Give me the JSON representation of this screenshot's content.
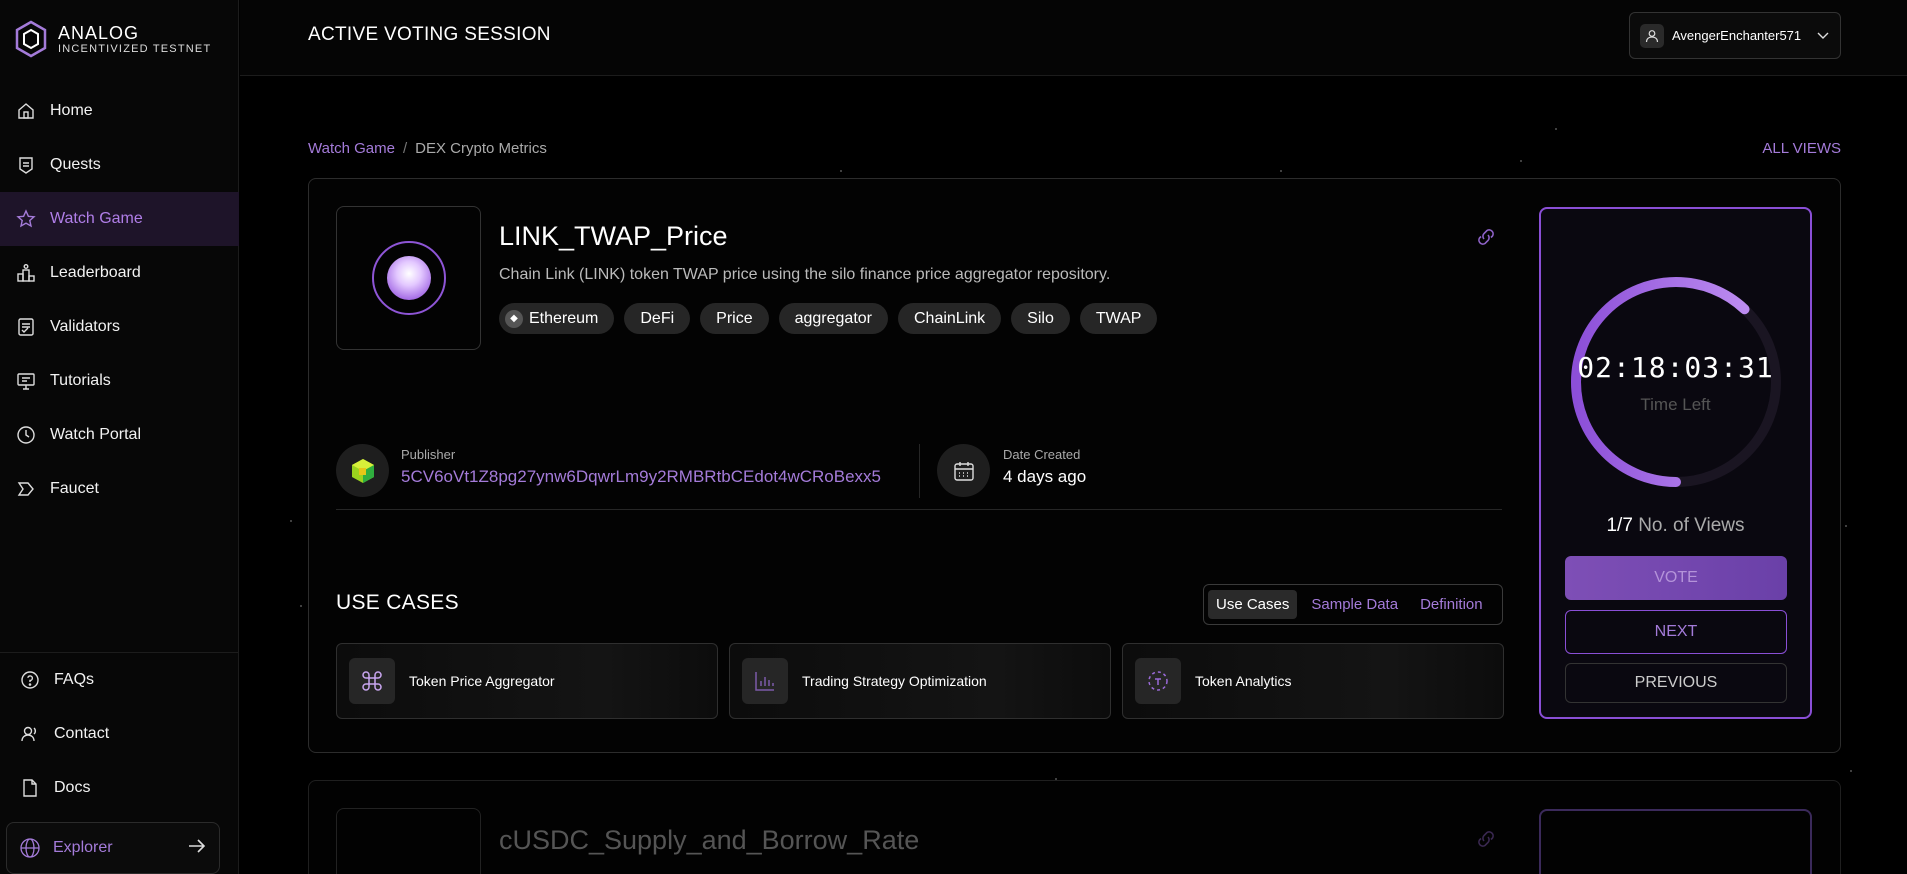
{
  "app": {
    "logo_title": "ANALOG",
    "logo_subtitle": "INCENTIVIZED TESTNET"
  },
  "sidebar": {
    "items": [
      {
        "label": "Home",
        "icon": "home-icon"
      },
      {
        "label": "Quests",
        "icon": "quests-icon"
      },
      {
        "label": "Watch Game",
        "icon": "star-icon",
        "active": true
      },
      {
        "label": "Leaderboard",
        "icon": "leaderboard-icon"
      },
      {
        "label": "Validators",
        "icon": "validators-icon"
      },
      {
        "label": "Tutorials",
        "icon": "tutorials-icon"
      },
      {
        "label": "Watch Portal",
        "icon": "clock-icon"
      },
      {
        "label": "Faucet",
        "icon": "faucet-icon"
      }
    ],
    "bottom_items": [
      {
        "label": "FAQs",
        "icon": "question-icon"
      },
      {
        "label": "Contact",
        "icon": "contact-icon"
      },
      {
        "label": "Docs",
        "icon": "docs-icon"
      }
    ],
    "explorer_label": "Explorer"
  },
  "header": {
    "title": "ACTIVE VOTING SESSION",
    "username": "AvengerEnchanter571"
  },
  "breadcrumb": {
    "root": "Watch Game",
    "separator": "/",
    "current": "DEX Crypto Metrics",
    "all_views": "ALL VIEWS"
  },
  "view": {
    "title": "LINK_TWAP_Price",
    "description": "Chain Link (LINK) token TWAP price using the silo finance price aggregator repository.",
    "tags": [
      "Ethereum",
      "DeFi",
      "Price",
      "aggregator",
      "ChainLink",
      "Silo",
      "TWAP"
    ],
    "publisher_label": "Publisher",
    "publisher": "5CV6oVt1Z8pg27ynw6DqwrLm9y2RMBRtbCEdot4wCRoBexx5",
    "date_label": "Date Created",
    "date": "4 days ago"
  },
  "use_cases": {
    "heading": "USE CASES",
    "tabs": [
      "Use Cases",
      "Sample Data",
      "Definition"
    ],
    "active_tab": "Use Cases",
    "cards": [
      {
        "label": "Token Price Aggregator",
        "icon": "command-icon"
      },
      {
        "label": "Trading Strategy Optimization",
        "icon": "bar-chart-icon"
      },
      {
        "label": "Token Analytics",
        "icon": "analytics-icon"
      }
    ]
  },
  "timer": {
    "time": "02:18:03:31",
    "label": "Time Left",
    "progress": 0.62,
    "views_count": "1/7",
    "views_label": "No. of Views",
    "vote": "VOTE",
    "next": "NEXT",
    "previous": "PREVIOUS"
  },
  "next_card": {
    "title": "cUSDC_Supply_and_Borrow_Rate"
  },
  "colors": {
    "accent": "#a47bd9",
    "accent_border": "#8a4fd6",
    "background": "#000000"
  }
}
